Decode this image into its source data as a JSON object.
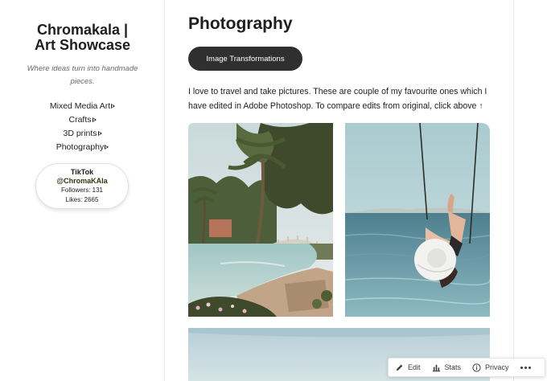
{
  "sidebar": {
    "site_title_line1": "Chromakala |",
    "site_title_line2": "Art Showcase",
    "tagline": "Where ideas turn into handmade pieces.",
    "nav_items": [
      {
        "label": "Mixed Media Art"
      },
      {
        "label": "Crafts"
      },
      {
        "label": "3D prints"
      },
      {
        "label": "Photography"
      }
    ],
    "tiktok": {
      "title": "TikTok",
      "handle": "@ChromaKAla",
      "followers": "Followers: 131",
      "likes": "Likes: 2665"
    }
  },
  "main": {
    "page_title": "Photography",
    "button_label": "Image Transformations",
    "intro_text": "I love to travel and take pictures. These are couple of my favourite ones which I have edited in Adobe Photoshop. To compare edits from original, click above ↑"
  },
  "admin_bar": {
    "edit_label": "Edit",
    "stats_label": "Stats",
    "privacy_label": "Privacy",
    "icons": [
      "pencil-icon",
      "bar-chart-icon",
      "info-icon",
      "more-icon"
    ]
  }
}
